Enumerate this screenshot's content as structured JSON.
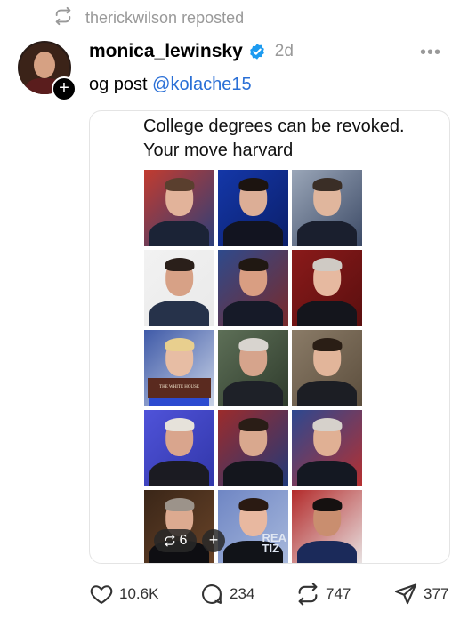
{
  "repost": {
    "user": "therickwilson",
    "label": "reposted"
  },
  "post": {
    "username": "monica_lewinsky",
    "timestamp": "2d",
    "caption_prefix": "og post ",
    "mention": "@kolache15"
  },
  "card": {
    "title": "College degrees can be revoked.\nYour move harvard",
    "white_house_text": "THE WHITE HOUSE",
    "overlay_text": "REA\nTIZ",
    "repost_count": "6"
  },
  "tiles": [
    {
      "bg": "#c23b2f",
      "bg2": "#2b3f7a",
      "skin": "#e2b39a",
      "hair": "#5a3f2e",
      "suit": "#1b2336"
    },
    {
      "bg": "#1437a8",
      "bg2": "#0b1f6a",
      "skin": "#dcae96",
      "hair": "#1c1410",
      "suit": "#121420"
    },
    {
      "bg": "#9aa6b8",
      "bg2": "#3c4a66",
      "skin": "#e0b69d",
      "hair": "#3a2e26",
      "suit": "#1a1f2e"
    },
    {
      "bg": "#f2f2f2",
      "bg2": "#e9e9e9",
      "skin": "#d7a186",
      "hair": "#2a1f1a",
      "suit": "#26324a"
    },
    {
      "bg": "#2e4a8c",
      "bg2": "#7a2a2a",
      "skin": "#d99e82",
      "hair": "#201812",
      "suit": "#161a28"
    },
    {
      "bg": "#8a1a1a",
      "bg2": "#5a0f0f",
      "skin": "#e6b9a0",
      "hair": "#cfcac4",
      "suit": "#14151c"
    },
    {
      "bg": "#3f5aa8",
      "bg2": "#c9d3e6",
      "skin": "#e7bda4",
      "hair": "#e8cf8e",
      "suit": "#2c4bd0"
    },
    {
      "bg": "#5d6f57",
      "bg2": "#2f3b2c",
      "skin": "#d6a48c",
      "hair": "#d8d4cf",
      "suit": "#1e2128"
    },
    {
      "bg": "#8a7b67",
      "bg2": "#5c4e3d",
      "skin": "#e2b59a",
      "hair": "#2a1e15",
      "suit": "#1c1e24"
    },
    {
      "bg": "#4f53d9",
      "bg2": "#3136a8",
      "skin": "#d9a58d",
      "hair": "#e6e2da",
      "suit": "#1b1b22"
    },
    {
      "bg": "#9c2b2b",
      "bg2": "#203a7a",
      "skin": "#d9a88e",
      "hair": "#2a1d16",
      "suit": "#14161d"
    },
    {
      "bg": "#2c4890",
      "bg2": "#b63030",
      "skin": "#e0b094",
      "hair": "#d6d1cb",
      "suit": "#141822"
    },
    {
      "bg": "#3a2618",
      "bg2": "#6a4428",
      "skin": "#dcaa90",
      "hair": "#9c938a",
      "suit": "#0e0e12"
    },
    {
      "bg": "#6f86c4",
      "bg2": "#a8b9dc",
      "skin": "#e8b8a0",
      "hair": "#2a1a12",
      "suit": "#111318"
    },
    {
      "bg": "#b32a2a",
      "bg2": "#e9e6e6",
      "skin": "#c98e6f",
      "hair": "#151110",
      "suit": "#1b2a5a"
    }
  ],
  "actions": {
    "likes": "10.6K",
    "comments": "234",
    "reposts": "747",
    "shares": "377"
  },
  "colors": {
    "mention": "#2a6fd6",
    "muted": "#999999",
    "verified": "#1d9bf0"
  },
  "icons": {
    "repost": "repost-icon",
    "verified": "verified-badge-icon",
    "like": "heart-icon",
    "comment": "comment-icon",
    "share": "send-icon",
    "more": "more-icon"
  }
}
